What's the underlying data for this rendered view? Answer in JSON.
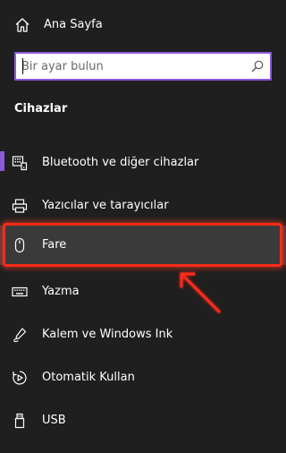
{
  "home": {
    "label": "Ana Sayfa",
    "icon": "home-icon"
  },
  "search": {
    "placeholder": "Bir ayar bulun",
    "icon": "search-icon"
  },
  "section": {
    "title": "Cihazlar"
  },
  "nav": {
    "items": [
      {
        "label": "Bluetooth ve diğer cihazlar",
        "icon": "bluetooth-devices-icon",
        "selected": true
      },
      {
        "label": "Yazıcılar ve tarayıcılar",
        "icon": "printer-icon"
      },
      {
        "label": "Fare",
        "icon": "mouse-icon",
        "highlighted": true
      },
      {
        "label": "Yazma",
        "icon": "keyboard-icon"
      },
      {
        "label": "Kalem ve Windows Ink",
        "icon": "pen-icon"
      },
      {
        "label": "Otomatik Kullan",
        "icon": "autoplay-icon"
      },
      {
        "label": "USB",
        "icon": "usb-icon"
      }
    ]
  },
  "colors": {
    "background": "#1f1f1f",
    "accent": "#8c5ad8",
    "annotation": "#ff2a1a",
    "hover": "#3a3a3a"
  }
}
